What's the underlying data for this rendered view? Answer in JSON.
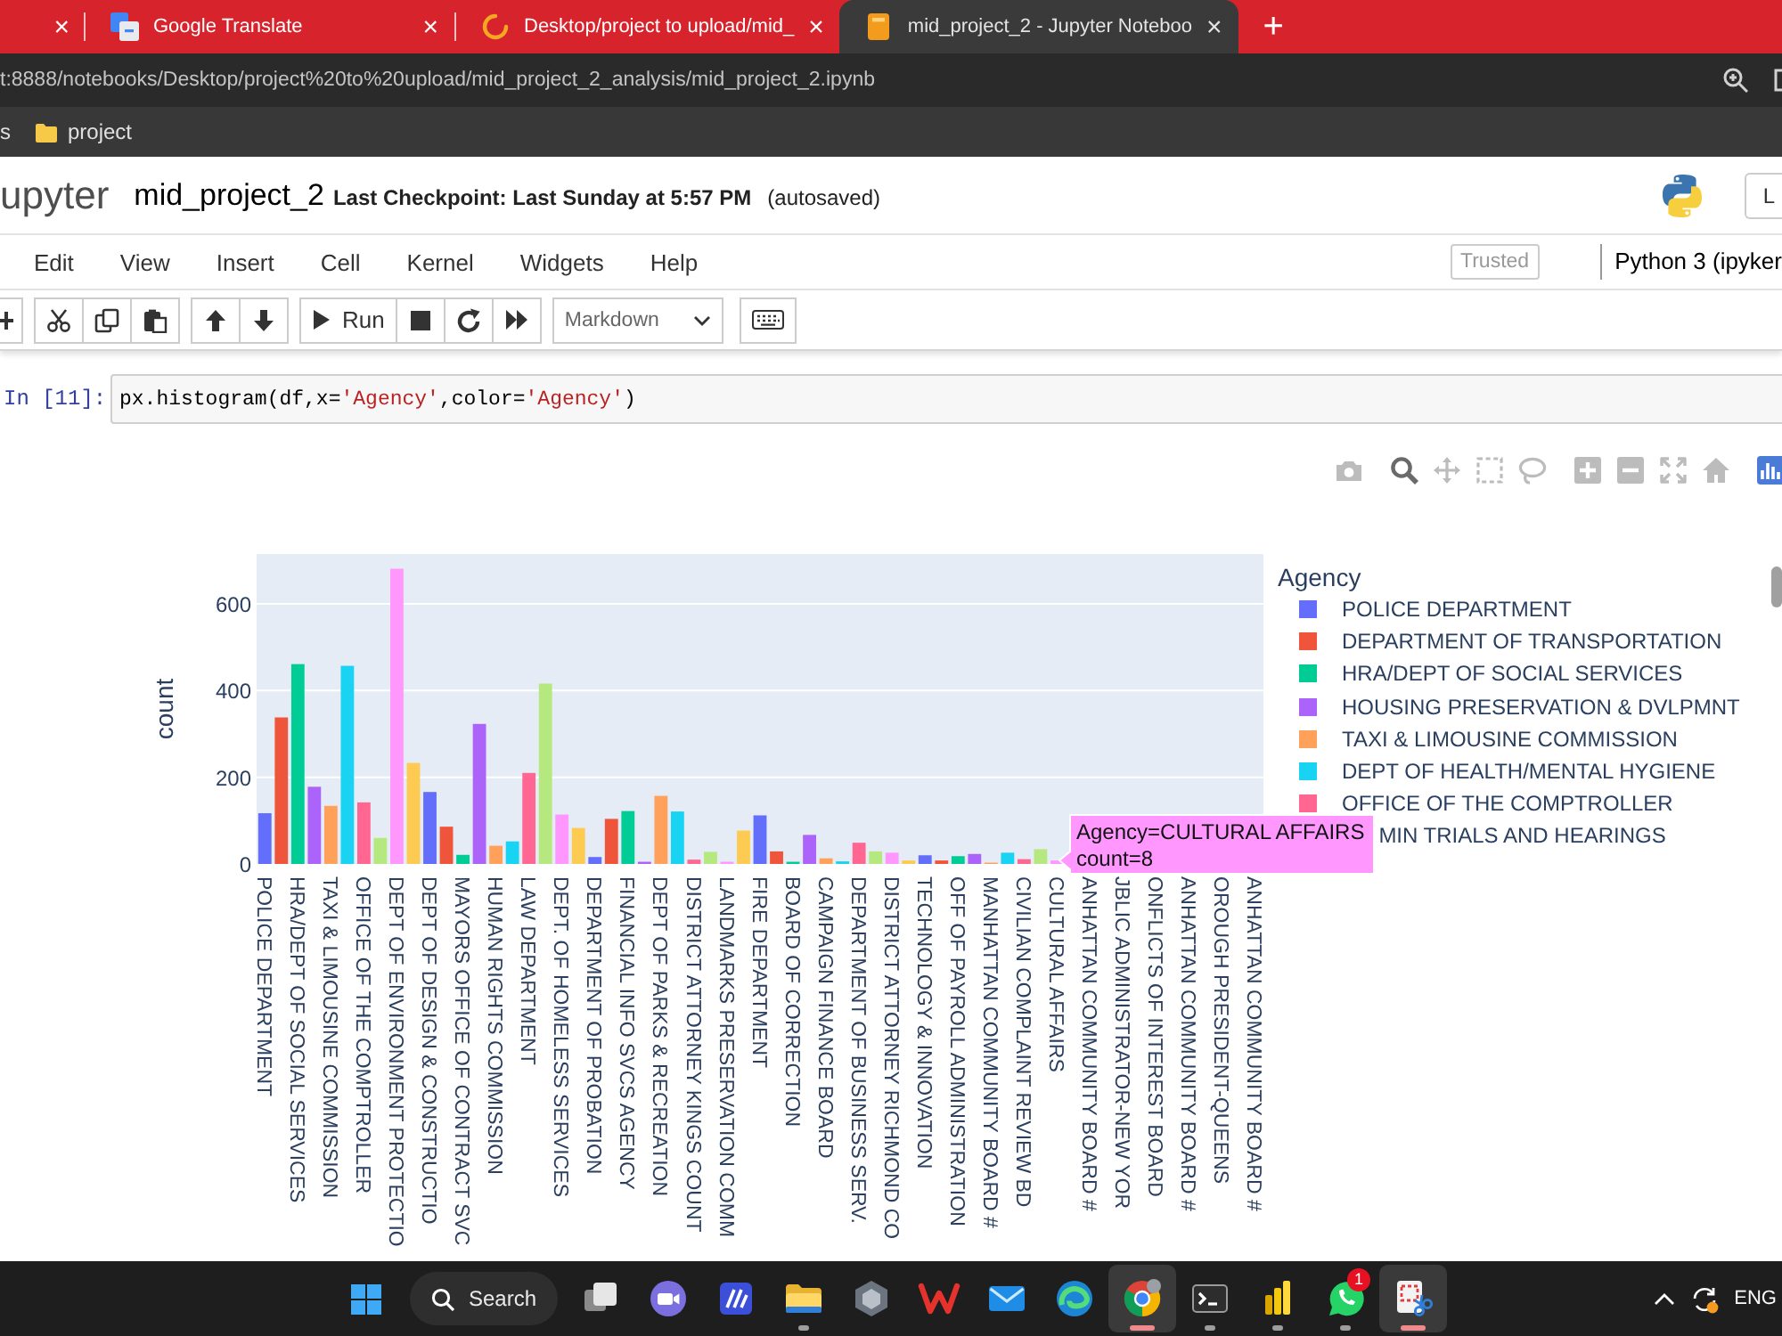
{
  "browser": {
    "tabs": [
      {
        "kind": "blank",
        "close": "×",
        "selected": false
      },
      {
        "kind": "translate",
        "title": "Google Translate",
        "close": "×",
        "selected": false
      },
      {
        "kind": "loading",
        "title": "Desktop/project to upload/mid_",
        "close": "×",
        "selected": false
      },
      {
        "kind": "notebook",
        "title": "mid_project_2 - Jupyter Noteboo",
        "close": "×",
        "selected": true
      }
    ],
    "new_tab": "+",
    "url": "t:8888/notebooks/Desktop/project%20to%20upload/mid_project_2_analysis/mid_project_2.ipynb",
    "bookmarks": [
      {
        "kind": "text",
        "label": "s"
      },
      {
        "kind": "folder",
        "label": "project"
      }
    ]
  },
  "notebook": {
    "header": {
      "logo": "upyter",
      "name": "mid_project_2",
      "checkpoint": "Last Checkpoint: Last Sunday at 5:57 PM",
      "autosave": "(autosaved)",
      "button": "L"
    },
    "menu": [
      "Edit",
      "View",
      "Insert",
      "Cell",
      "Kernel",
      "Widgets",
      "Help"
    ],
    "trusted": "Trusted",
    "kernel": "Python 3 (ipyker",
    "toolbar": [
      [
        {
          "kind": "add"
        }
      ],
      [
        {
          "kind": "cut"
        },
        {
          "kind": "copy"
        },
        {
          "kind": "paste"
        }
      ],
      [
        {
          "kind": "move-up"
        },
        {
          "kind": "move-down"
        }
      ],
      [
        {
          "kind": "run",
          "label": "Run"
        },
        {
          "kind": "stop"
        },
        {
          "kind": "restart"
        },
        {
          "kind": "run-all"
        }
      ],
      [
        {
          "kind": "select",
          "value": "Markdown"
        }
      ],
      [
        {
          "kind": "keyboard"
        }
      ]
    ],
    "cell": {
      "prompt": "In [11]:",
      "code": [
        {
          "kind": "plain",
          "text": "px.histogram(df,x="
        },
        {
          "kind": "string",
          "text": "'Agency'"
        },
        {
          "kind": "plain",
          "text": ",color="
        },
        {
          "kind": "string",
          "text": "'Agency'"
        },
        {
          "kind": "plain",
          "text": ")"
        }
      ]
    },
    "output": {
      "modebar": [
        [
          {
            "kind": "camera",
            "selected": false
          }
        ],
        [
          {
            "kind": "zoom",
            "selected": true
          },
          {
            "kind": "pan",
            "selected": false
          },
          {
            "kind": "box-select",
            "selected": false
          },
          {
            "kind": "lasso",
            "selected": false
          }
        ],
        [
          {
            "kind": "zoom-in",
            "selected": false
          },
          {
            "kind": "zoom-out",
            "selected": false
          },
          {
            "kind": "autoscale",
            "selected": false
          },
          {
            "kind": "home",
            "selected": false
          }
        ]
      ],
      "chart_data": [
        {
          "type": "bar",
          "ylabel": "count",
          "grid": true,
          "yticks": [
            0,
            200,
            400,
            600
          ],
          "ylim": [
            0,
            715
          ],
          "categories": [
            "POLICE DEPARTMENT",
            null,
            "HRA/DEPT OF SOCIAL SERVICES",
            null,
            "TAXI & LIMOUSINE COMMISSION",
            null,
            "OFFICE OF THE COMPTROLLER",
            null,
            "DEPT OF ENVIRONMENT PROTECTIO",
            null,
            "DEPT OF DESIGN & CONSTRUCTIO",
            null,
            "MAYORS OFFICE OF CONTRACT SVC",
            null,
            "HUMAN RIGHTS COMMISSION",
            null,
            "LAW DEPARTMENT",
            null,
            "DEPT. OF HOMELESS SERVICES",
            null,
            "DEPARTMENT OF PROBATION",
            null,
            "FINANCIAL INFO SVCS AGENCY",
            null,
            "DEPT OF PARKS & RECREATION",
            null,
            "DISTRICT ATTORNEY KINGS COUNT",
            null,
            "LANDMARKS PRESERVATION COMM",
            null,
            "FIRE DEPARTMENT",
            null,
            "BOARD OF CORRECTION",
            null,
            "CAMPAIGN FINANCE BOARD",
            null,
            "DEPARTMENT OF BUSINESS SERV.",
            null,
            "DISTRICT ATTORNEY RICHMOND CO",
            null,
            "TECHNOLOGY & INNOVATION",
            null,
            "OFF OF PAYROLL ADMINISTRATION",
            null,
            "MANHATTAN COMMUNITY BOARD #",
            null,
            "CIVILIAN COMPLAINT REVIEW BD",
            null,
            "CULTURAL AFFAIRS",
            null,
            "ANHATTAN COMMUNITY BOARD #",
            null,
            "JBLIC ADMINISTRATOR-NEW YOR",
            null,
            "ONFLICTS OF INTEREST BOARD",
            null,
            "ANHATTAN COMMUNITY BOARD #",
            null,
            "OROUGH PRESIDENT-QUEENS",
            null,
            "ANHATTAN COMMUNITY BOARD #"
          ],
          "values": [
            117,
            338,
            461,
            178,
            134,
            457,
            142,
            60,
            681,
            233,
            166,
            86,
            21,
            323,
            42,
            52,
            210,
            416,
            114,
            83,
            16,
            104,
            122,
            5,
            157,
            121,
            10,
            28,
            5,
            77,
            112,
            29,
            5,
            67,
            13,
            6,
            49,
            29,
            26,
            8,
            20,
            8,
            18,
            23,
            3,
            26,
            11,
            34,
            8,
            null,
            null,
            null,
            null,
            null,
            null,
            null,
            null,
            null,
            null,
            null,
            null
          ],
          "colors": [
            "#636efa",
            "#ef553b",
            "#00cc96",
            "#ab63fa",
            "#ffa15a",
            "#19d3f3",
            "#ff6692",
            "#b6e880",
            "#ff97ff",
            "#fecb52",
            "#636efa",
            "#ef553b",
            "#00cc96",
            "#ab63fa",
            "#ffa15a",
            "#19d3f3",
            "#ff6692",
            "#b6e880",
            "#ff97ff",
            "#fecb52",
            "#636efa",
            "#ef553b",
            "#00cc96",
            "#ab63fa",
            "#ffa15a",
            "#19d3f3",
            "#ff6692",
            "#b6e880",
            "#ff97ff",
            "#fecb52",
            "#636efa",
            "#ef553b",
            "#00cc96",
            "#ab63fa",
            "#ffa15a",
            "#19d3f3",
            "#ff6692",
            "#b6e880",
            "#ff97ff",
            "#fecb52",
            "#636efa",
            "#ef553b",
            "#00cc96",
            "#ab63fa",
            "#ffa15a",
            "#19d3f3",
            "#ff6692",
            "#b6e880",
            "#ff97ff",
            null,
            null,
            null,
            null,
            null,
            null,
            null,
            null,
            null,
            null,
            null,
            null
          ],
          "annotations": [
            "Agency=CULTURAL AFFAIRS",
            "count=8"
          ]
        }
      ],
      "legend": {
        "title": "Agency",
        "items": [
          {
            "label": "POLICE DEPARTMENT",
            "color": "#636efa"
          },
          {
            "label": "DEPARTMENT OF TRANSPORTATION",
            "color": "#ef553b"
          },
          {
            "label": "HRA/DEPT OF SOCIAL SERVICES",
            "color": "#00cc96"
          },
          {
            "label": "HOUSING PRESERVATION & DVLPMNT",
            "color": "#ab63fa"
          },
          {
            "label": "TAXI & LIMOUSINE COMMISSION",
            "color": "#ffa15a"
          },
          {
            "label": "DEPT OF HEALTH/MENTAL HYGIENE",
            "color": "#19d3f3"
          },
          {
            "label": "OFFICE OF THE COMPTROLLER",
            "color": "#ff6692"
          },
          {
            "label": "MIN TRIALS AND HEARINGS"
          }
        ]
      }
    }
  },
  "taskbar": {
    "search": "Search",
    "apps": [
      {
        "kind": "task-view",
        "running": false,
        "active": false
      },
      {
        "kind": "chat",
        "running": false,
        "active": false
      },
      {
        "kind": "design",
        "running": false,
        "active": false
      },
      {
        "kind": "explorer",
        "running": true,
        "active": false
      },
      {
        "kind": "hexagon",
        "running": false,
        "active": false
      },
      {
        "kind": "office",
        "running": false,
        "active": false
      },
      {
        "kind": "mail",
        "running": false,
        "active": false
      },
      {
        "kind": "edge",
        "running": false,
        "active": false
      },
      {
        "kind": "chrome",
        "running": true,
        "active": true
      },
      {
        "kind": "terminal",
        "running": true,
        "active": false
      },
      {
        "kind": "bi",
        "running": true,
        "active": false
      },
      {
        "kind": "whatsapp",
        "running": true,
        "active": false,
        "badge": "1"
      },
      {
        "kind": "snipping",
        "running": true,
        "active": true
      }
    ],
    "language": "ENG"
  }
}
